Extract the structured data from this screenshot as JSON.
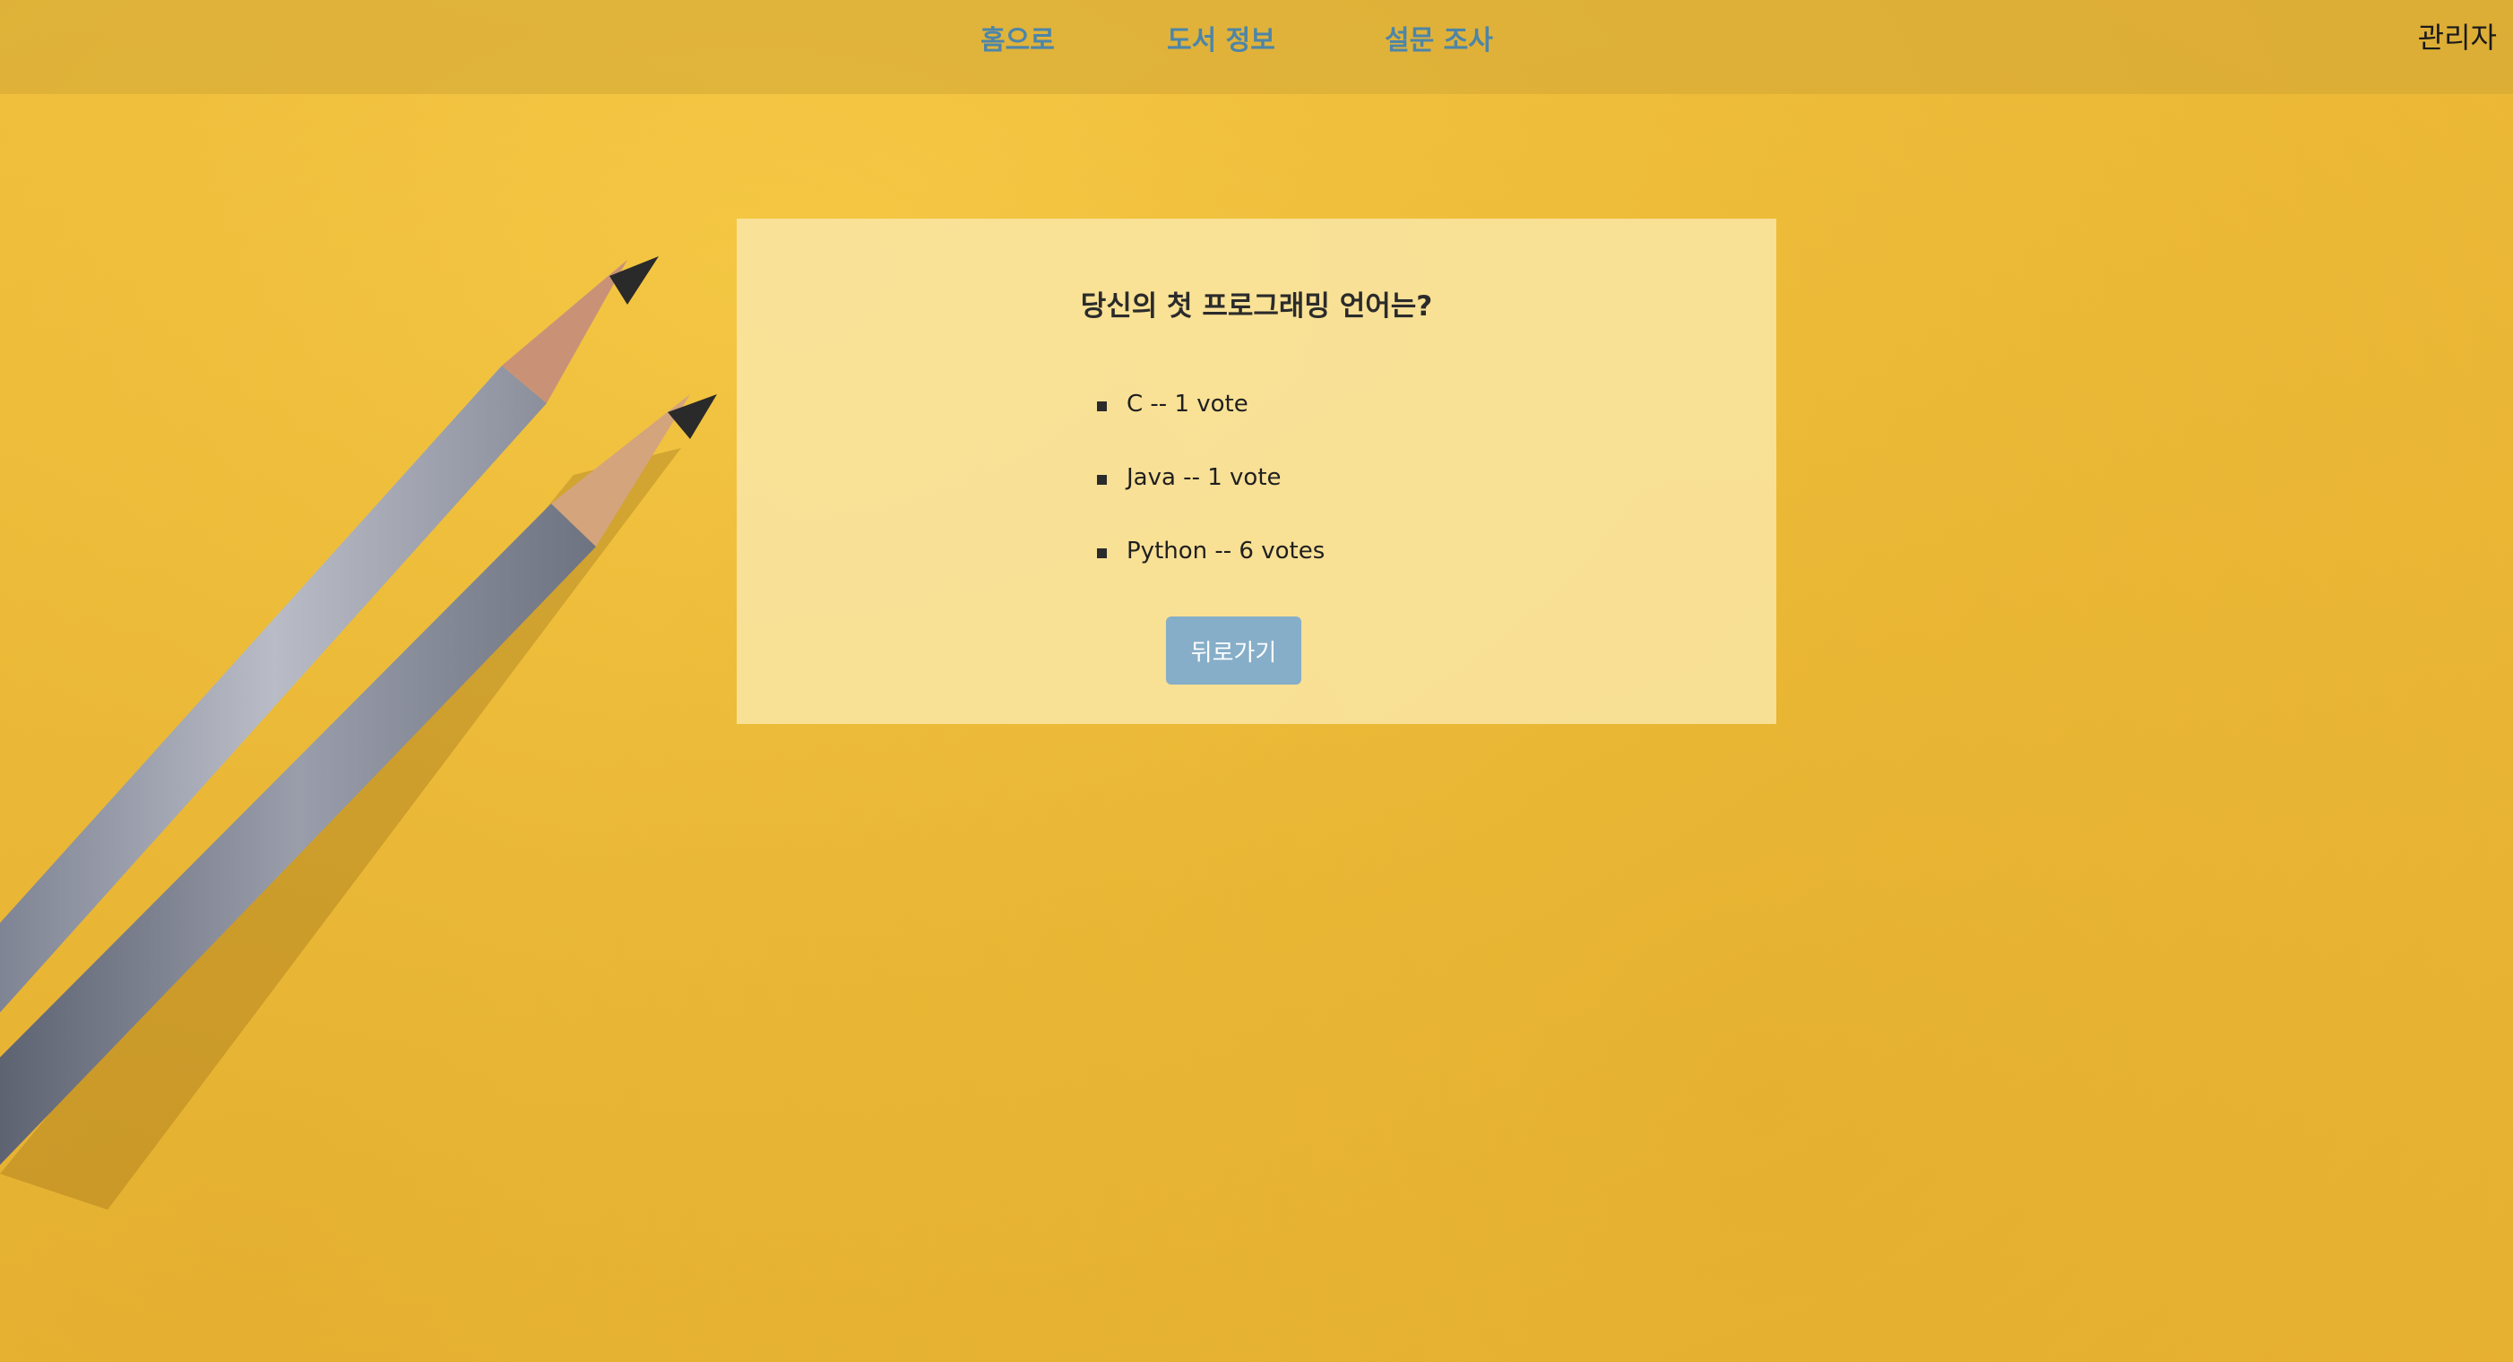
{
  "nav": {
    "home": "홈으로",
    "books": "도서 정보",
    "survey": "설문 조사",
    "admin": "관리자"
  },
  "poll": {
    "question": "당신의 첫 프로그래밍 언어는?",
    "options": [
      {
        "label": "C -- 1 vote"
      },
      {
        "label": "Java -- 1 vote"
      },
      {
        "label": "Python -- 6 votes"
      }
    ],
    "back_label": "뒤로가기"
  },
  "colors": {
    "background": "#efbe3a",
    "nav_link": "#4d85a8",
    "button": "#86aec8",
    "card": "#f8e6aa"
  }
}
